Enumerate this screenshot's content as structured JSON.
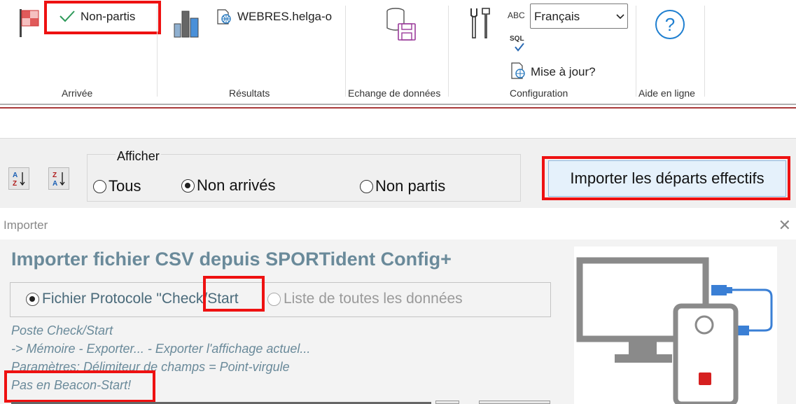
{
  "ribbon": {
    "non_partis_label": "Non-partis",
    "webres_label": "WEBRES.helga-o",
    "language_selected": "Français",
    "mise_a_jour_label": "Mise à jour?",
    "abc_label": "ABC",
    "sql_label": "SQL",
    "groups": {
      "arrivee": "Arrivée",
      "resultats": "Résultats",
      "echange": "Echange de données",
      "configuration": "Configuration",
      "aide": "Aide en ligne"
    }
  },
  "toolbar": {
    "sort_asc_label": "A↓Z",
    "sort_desc_label": "Z↓A",
    "afficher_legend": "Afficher",
    "radio_tous": "Tous",
    "radio_non_arrives": "Non arrivés",
    "radio_non_partis": "Non partis",
    "selected_radio": "Non arrivés",
    "import_button": "Importer les départs effectifs"
  },
  "dialog": {
    "title": "Importer",
    "close_glyph": "✕",
    "heading": "Importer fichier CSV depuis SPORTident Config+",
    "option_protocol": "Fichier Protocole \"Check/Start",
    "option_list": "Liste de toutes les données",
    "selected_option": "Fichier Protocole \"Check/Start",
    "info_lines": [
      "Poste Check/Start",
      "-> Mémoire - Exporter... - Exporter l'affichage actuel...",
      "Paramètres: Délimiteur de champs = Point-virgule",
      "Pas en Beacon-Start!"
    ]
  },
  "colors": {
    "highlight_red": "#ee1111",
    "dialog_text": "#6a8a9a",
    "button_bg": "#e5f1fb"
  },
  "icons": [
    "flag-icon",
    "check-icon",
    "bar-chart-icon",
    "web-document-icon",
    "database-save-icon",
    "tools-icon",
    "spellcheck-icon",
    "update-icon",
    "help-icon",
    "sort-asc-icon",
    "sort-desc-icon",
    "close-icon",
    "computer-usb-icon"
  ]
}
